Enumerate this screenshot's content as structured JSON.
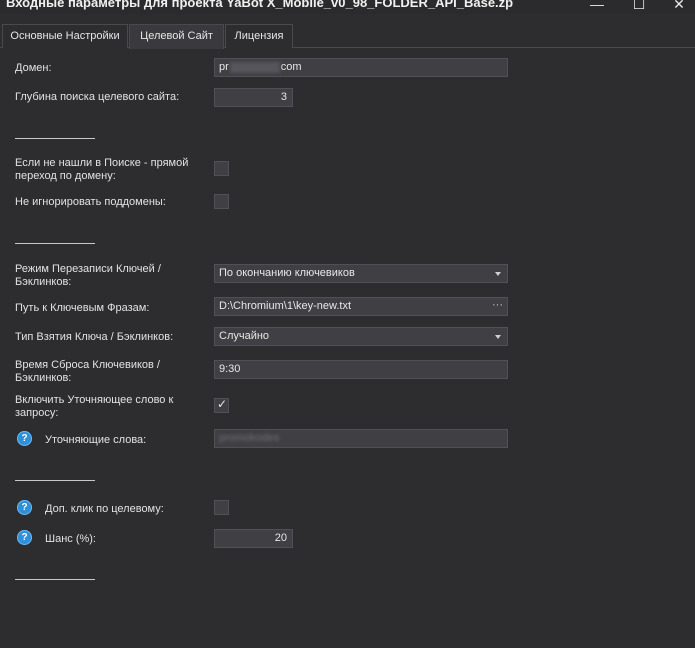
{
  "window": {
    "title": "Входные параметры для проекта YaBot X_Mobile_v0_98_FOLDER_API_Base.zp",
    "minimize": "—",
    "maximize": "☐",
    "close": "✕"
  },
  "tabs": [
    {
      "label": "Основные Настройки",
      "active": false
    },
    {
      "label": "Целевой Сайт",
      "active": true
    },
    {
      "label": "Лицензия",
      "active": false
    }
  ],
  "fields": {
    "domain": {
      "label": "Домен:",
      "prefix": "pr",
      "suffix": "com"
    },
    "depth": {
      "label": "Глубина поиска целевого сайта:",
      "value": "3"
    },
    "direct_jump": {
      "label": "Если не нашли в Поиске - прямой переход по домену:",
      "checked": false
    },
    "subdomains": {
      "label": "Не игнорировать поддомены:",
      "checked": false
    },
    "rewrite_mode": {
      "label": "Режим Перезаписи Ключей / Бэклинков:",
      "value": "По окончанию ключевиков"
    },
    "keys_path": {
      "label": "Путь к Ключевым Фразам:",
      "value": "D:\\Chromium\\1\\key-new.txt",
      "browse": "···"
    },
    "take_type": {
      "label": "Тип Взятия Ключа / Бэклинков:",
      "value": "Случайно"
    },
    "reset_time": {
      "label": "Время Сброса Ключевиков / Бэклинков:",
      "value": "9:30"
    },
    "refine_enable": {
      "label": "Включить Уточняющее слово к запросу:",
      "checked": true
    },
    "refine_words": {
      "label": "Уточняющие слова:",
      "value": "promokodes"
    },
    "extra_click": {
      "label": "Доп. клик по целевому:",
      "checked": false
    },
    "chance": {
      "label": "Шанс (%):",
      "value": "20"
    }
  },
  "icons": {
    "help": "?",
    "check": "✓"
  },
  "colors": {
    "background": "#2d2d30",
    "input": "#3f3f44",
    "help_icon": "#2f8fd8"
  }
}
